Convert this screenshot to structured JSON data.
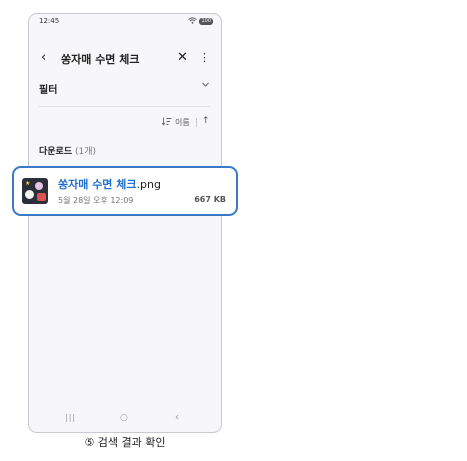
{
  "status_bar": {
    "time": "12:45",
    "wifi_icon": "wifi-icon",
    "battery": "100"
  },
  "header": {
    "back_icon": "‹",
    "title": "쏭자매 수면 체크",
    "close_icon": "✕",
    "more_icon": "⋮"
  },
  "filter": {
    "label": "필터",
    "chevron_icon": "⌄"
  },
  "sort": {
    "icon": "↓≡",
    "label": "이름",
    "direction_icon": "↑"
  },
  "section": {
    "title": "다운로드",
    "count": "(1개)"
  },
  "file": {
    "name_highlight": "쏭자매 수면 체크",
    "name_extension": ".png",
    "meta": "5월 28일 오후 12:09",
    "size": "667 KB"
  },
  "nav": {
    "recent": "|||",
    "home": "○",
    "back": "‹"
  },
  "caption": "⑤ 검색 결과 확인",
  "colors": {
    "accent": "#3a78c9",
    "highlight_text": "#1f6fd1"
  }
}
